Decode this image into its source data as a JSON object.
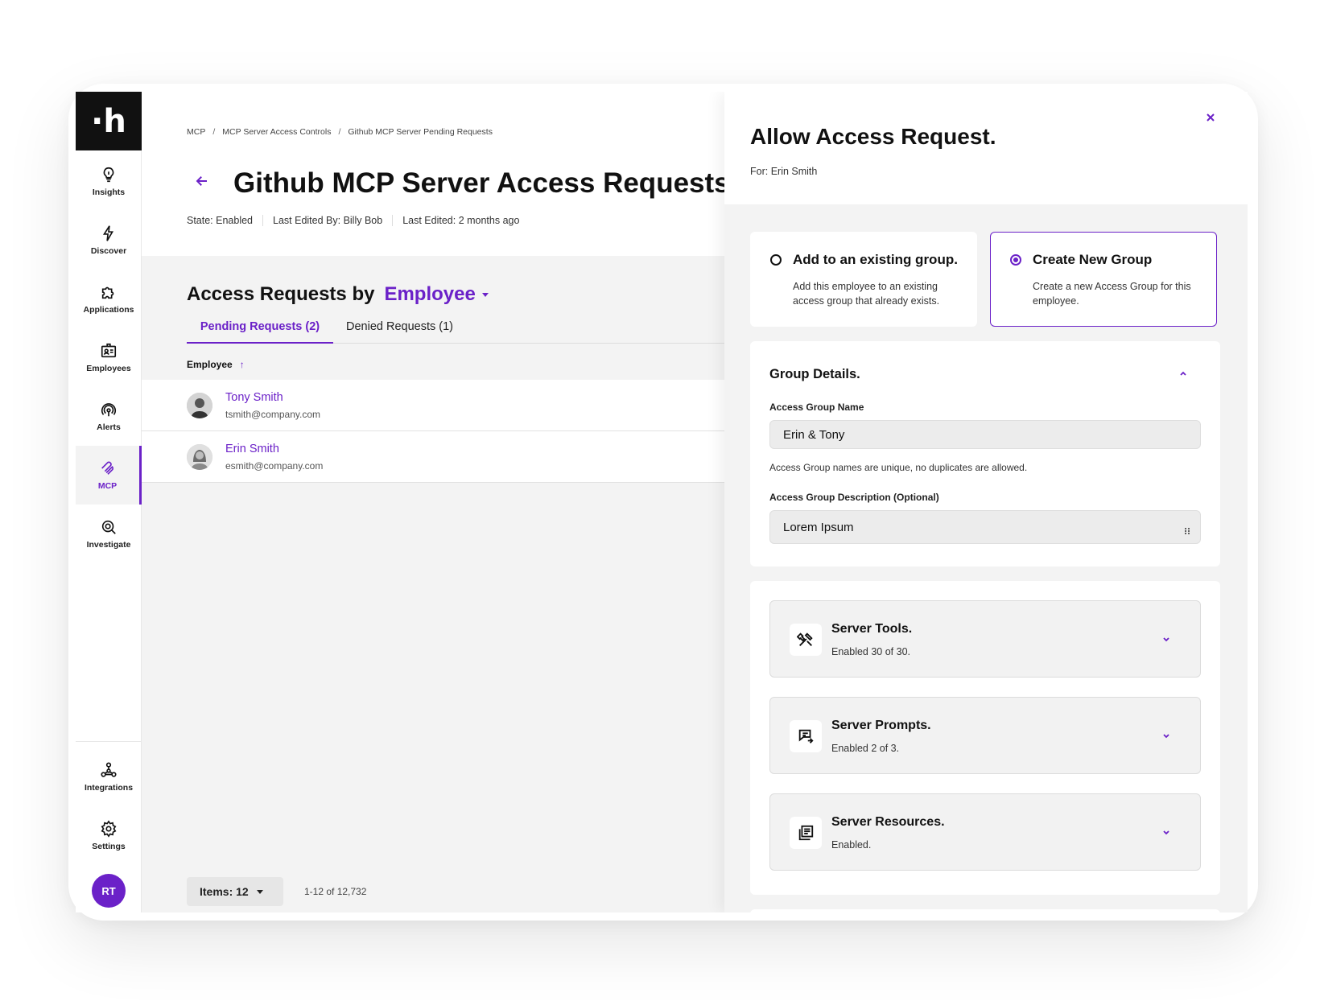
{
  "sidebar": {
    "logo": "·h",
    "items": [
      {
        "label": "Insights",
        "icon": "lightbulb-icon"
      },
      {
        "label": "Discover",
        "icon": "bolt-icon"
      },
      {
        "label": "Applications",
        "icon": "puzzle-icon"
      },
      {
        "label": "Employees",
        "icon": "id-badge-icon"
      },
      {
        "label": "Alerts",
        "icon": "signal-icon"
      },
      {
        "label": "MCP",
        "icon": "mcp-icon",
        "active": true
      },
      {
        "label": "Investigate",
        "icon": "investigate-icon"
      }
    ],
    "bottom_items": [
      {
        "label": "Integrations",
        "icon": "integrations-icon"
      },
      {
        "label": "Settings",
        "icon": "gear-icon"
      }
    ],
    "user_initials": "RT",
    "accent_color": "#6b21c8"
  },
  "breadcrumb": [
    "MCP",
    "MCP Server Access Controls",
    "Github MCP Server Pending Requests"
  ],
  "breadcrumb_separator": "/",
  "page": {
    "title": "Github MCP Server Access Requests",
    "meta": [
      "State: Enabled",
      "Last Edited By: Billy Bob",
      "Last Edited: 2 months ago"
    ]
  },
  "requests": {
    "heading": "Access Requests by",
    "group_by": "Employee",
    "tabs": [
      {
        "label": "Pending Requests (2)",
        "active": true
      },
      {
        "label": "Denied Requests (1)",
        "active": false
      }
    ],
    "column": "Employee",
    "sort_icon": "↑",
    "rows": [
      {
        "name": "Tony Smith",
        "email": "tsmith@company.com"
      },
      {
        "name": "Erin Smith",
        "email": "esmith@company.com"
      }
    ],
    "items_label": "Items: 12",
    "pagination": "1-12 of 12,732"
  },
  "panel": {
    "title": "Allow Access Request.",
    "for": "For: Erin Smith",
    "options": [
      {
        "title": "Add to an existing group.",
        "desc": "Add this employee to an existing access group that already exists.",
        "selected": false
      },
      {
        "title": "Create New Group",
        "desc": "Create a new Access Group for this employee.",
        "selected": true
      }
    ],
    "details": {
      "title": "Group Details.",
      "name_label": "Access Group Name",
      "name_value": "Erin & Tony",
      "name_hint": "Access Group names are unique, no duplicates are allowed.",
      "desc_label": "Access Group Description (Optional)",
      "desc_value": "Lorem Ipsum"
    },
    "server": [
      {
        "title": "Server Tools.",
        "sub": "Enabled 30 of 30.",
        "icon": "tools-icon"
      },
      {
        "title": "Server Prompts.",
        "sub": "Enabled 2 of 3.",
        "icon": "prompt-icon"
      },
      {
        "title": "Server Resources.",
        "sub": "Enabled.",
        "icon": "resources-icon"
      }
    ]
  }
}
